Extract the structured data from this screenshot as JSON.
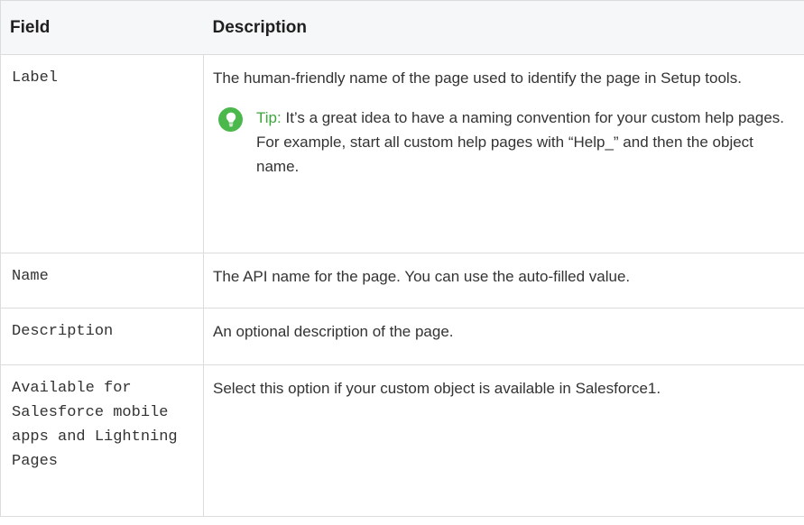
{
  "table": {
    "headers": {
      "field": "Field",
      "description": "Description"
    },
    "rows": [
      {
        "field": "Label",
        "description": "The human-friendly name of the page used to identify the page in Setup tools.",
        "tip": {
          "heading": "Tip",
          "text": "It’s a great idea to have a naming convention for your custom help pages. For example, start all custom help pages with “Help_” and then the object name.",
          "icon": "lightbulb-icon",
          "color": "#4bb84b"
        }
      },
      {
        "field": "Name",
        "description": "The API name for the page. You can use the auto-filled value."
      },
      {
        "field": "Description",
        "description": "An optional description of the page."
      },
      {
        "field": "Available for Salesforce mobile apps and Lightning Pages",
        "description": "Select this option if your custom object is available in Salesforce1."
      }
    ]
  }
}
